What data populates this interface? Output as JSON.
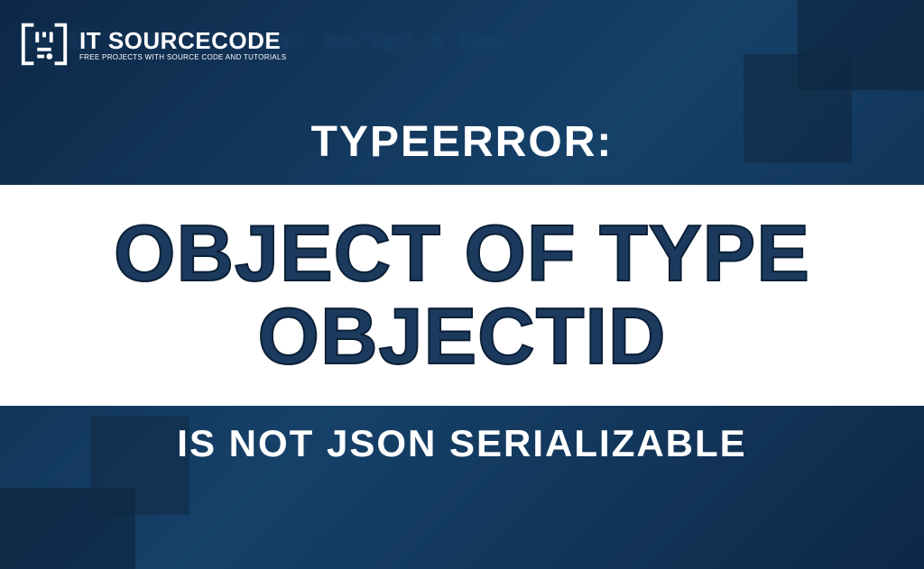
{
  "logo": {
    "title": "IT SOURCECODE",
    "subtitle": "FREE PROJECTS WITH SOURCE CODE AND TUTORIALS"
  },
  "heading": {
    "line1": "TYPEERROR:",
    "line2": "OBJECT OF TYPE OBJECTID",
    "line3": "IS NOT JSON SERIALIZABLE"
  },
  "code_blur_lines": "34\n35  }\n36\n37  }\n   var marker = new"
}
